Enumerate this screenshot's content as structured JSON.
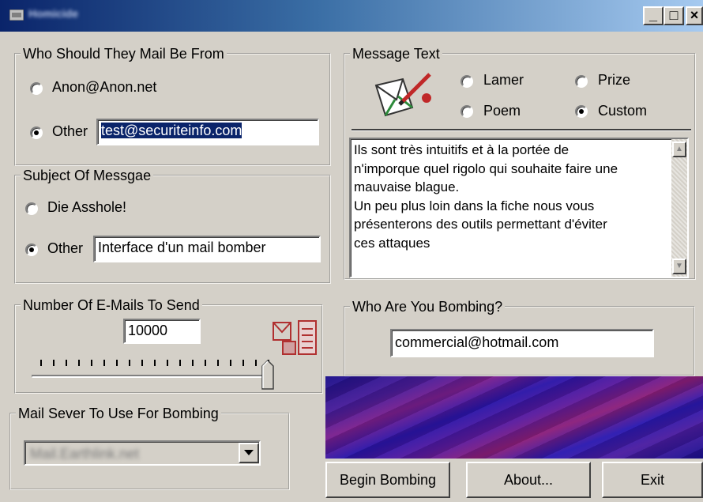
{
  "window": {
    "title": "Homicide",
    "minimize_glyph": "_",
    "maximize_glyph": "□",
    "close_glyph": "×"
  },
  "from_group": {
    "legend": "Who Should They Mail Be From",
    "option_anon": "Anon@Anon.net",
    "option_other": "Other",
    "other_value": "test@securiteinfo.com",
    "selected": "Other"
  },
  "subject_group": {
    "legend": "Subject Of Messgae",
    "option_die": "Die Asshole!",
    "option_other": "Other",
    "other_value": "Interface d'un mail bomber",
    "selected": "Other"
  },
  "count_group": {
    "legend": "Number Of E-Mails To Send",
    "value": "10000",
    "slider_level_percent": 100
  },
  "server_group": {
    "legend": "Mail Sever To Use For Bombing",
    "selected_value": "Mail.Earthlink.net"
  },
  "message_group": {
    "legend": "Message Text",
    "option_lamer": "Lamer",
    "option_prize": "Prize",
    "option_poem": "Poem",
    "option_custom": "Custom",
    "selected": "Custom",
    "text_lines": [
      "Ils sont très intuitifs et à la portée de",
      "n'imporque quel rigolo qui souhaite faire une",
      "mauvaise blague.",
      "Un peu plus loin dans la fiche nous vous",
      "présenterons des outils permettant d'éviter",
      "ces attaques"
    ]
  },
  "target_group": {
    "legend": "Who Are You Bombing?",
    "value": "commercial@hotmail.com"
  },
  "buttons": {
    "begin": "Begin Bombing",
    "about": "About...",
    "exit": "Exit"
  },
  "colors": {
    "face": "#d4d0c8",
    "title_dark": "#0a246a",
    "title_light": "#a6caf0",
    "selection": "#0a246a"
  },
  "icons": {
    "title": "app-icon",
    "message": "envelope-pencil-icon",
    "count": "mail-counter-icon",
    "dropdown": "chevron-down-icon"
  }
}
